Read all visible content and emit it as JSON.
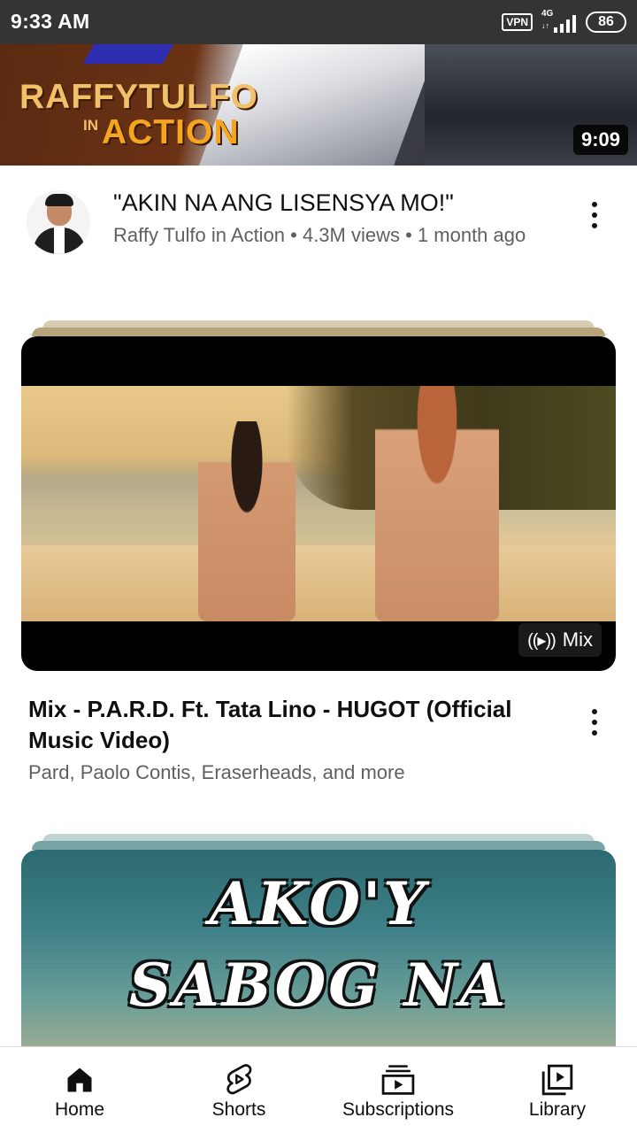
{
  "status_bar": {
    "time": "9:33 AM",
    "vpn": "VPN",
    "network": "4G",
    "battery": "86"
  },
  "feed": {
    "video1": {
      "thumbnail_logo_line1": "RAFFYTULFO",
      "thumbnail_logo_in": "IN",
      "thumbnail_logo_action": "ACTION",
      "duration": "9:09",
      "title": "\"AKIN NA ANG LISENSYA MO!\"",
      "subtitle": "Raffy Tulfo in Action • 4.3M views • 1 month ago"
    },
    "mix1": {
      "badge_label": "Mix",
      "title": "Mix - P.A.R.D. Ft. Tata Lino - HUGOT (Official Music Video)",
      "subtitle": "Pard, Paolo Contis, Eraserheads, and more"
    },
    "mix2": {
      "thumbnail_line1": "AKO'Y",
      "thumbnail_line2": "SABOG NA"
    }
  },
  "bottom_nav": {
    "home": "Home",
    "shorts": "Shorts",
    "subscriptions": "Subscriptions",
    "library": "Library"
  },
  "colors": {
    "status_bar_bg": "#343434",
    "text_primary": "#0f0f0f",
    "text_secondary": "#606060",
    "logo_gold": "#f2c069",
    "logo_orange": "#f7a51e"
  }
}
